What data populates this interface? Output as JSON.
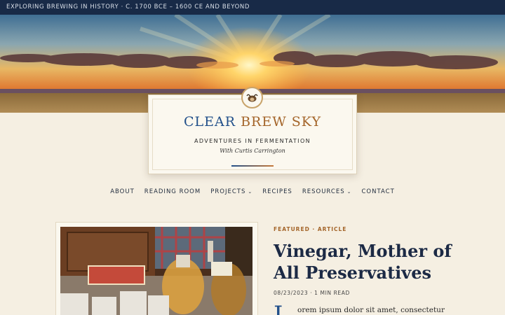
{
  "topbar": {
    "text": "EXPLORING BREWING IN HISTORY · C. 1700 BCE – 1600 CE AND BEYOND"
  },
  "hero": {
    "alt": "sunset-over-field"
  },
  "site": {
    "title_part1": "CLEAR",
    "title_part2": "BREW SKY",
    "tagline": "ADVENTURES IN FERMENTATION",
    "byline": "With Curtis Carrington"
  },
  "nav": {
    "items": [
      {
        "label": "ABOUT",
        "has_dropdown": false
      },
      {
        "label": "READING ROOM",
        "has_dropdown": false
      },
      {
        "label": "PROJECTS",
        "has_dropdown": true
      },
      {
        "label": "RECIPES",
        "has_dropdown": false
      },
      {
        "label": "RESOURCES",
        "has_dropdown": true
      },
      {
        "label": "CONTACT",
        "has_dropdown": false
      }
    ],
    "dropdown_icon": "chevron-down-icon"
  },
  "featured": {
    "label": "FEATURED · ARTICLE",
    "title": "Vinegar, Mother of All Preservatives",
    "meta": "08/23/2023 · 1 MIN READ",
    "dropcap": "L",
    "excerpt": "orem ipsum dolor sit amet, consectetur"
  },
  "colors": {
    "topbar_bg": "#182a47",
    "page_bg": "#f5efe2",
    "accent_blue": "#22508a",
    "accent_brown": "#a4652a"
  }
}
